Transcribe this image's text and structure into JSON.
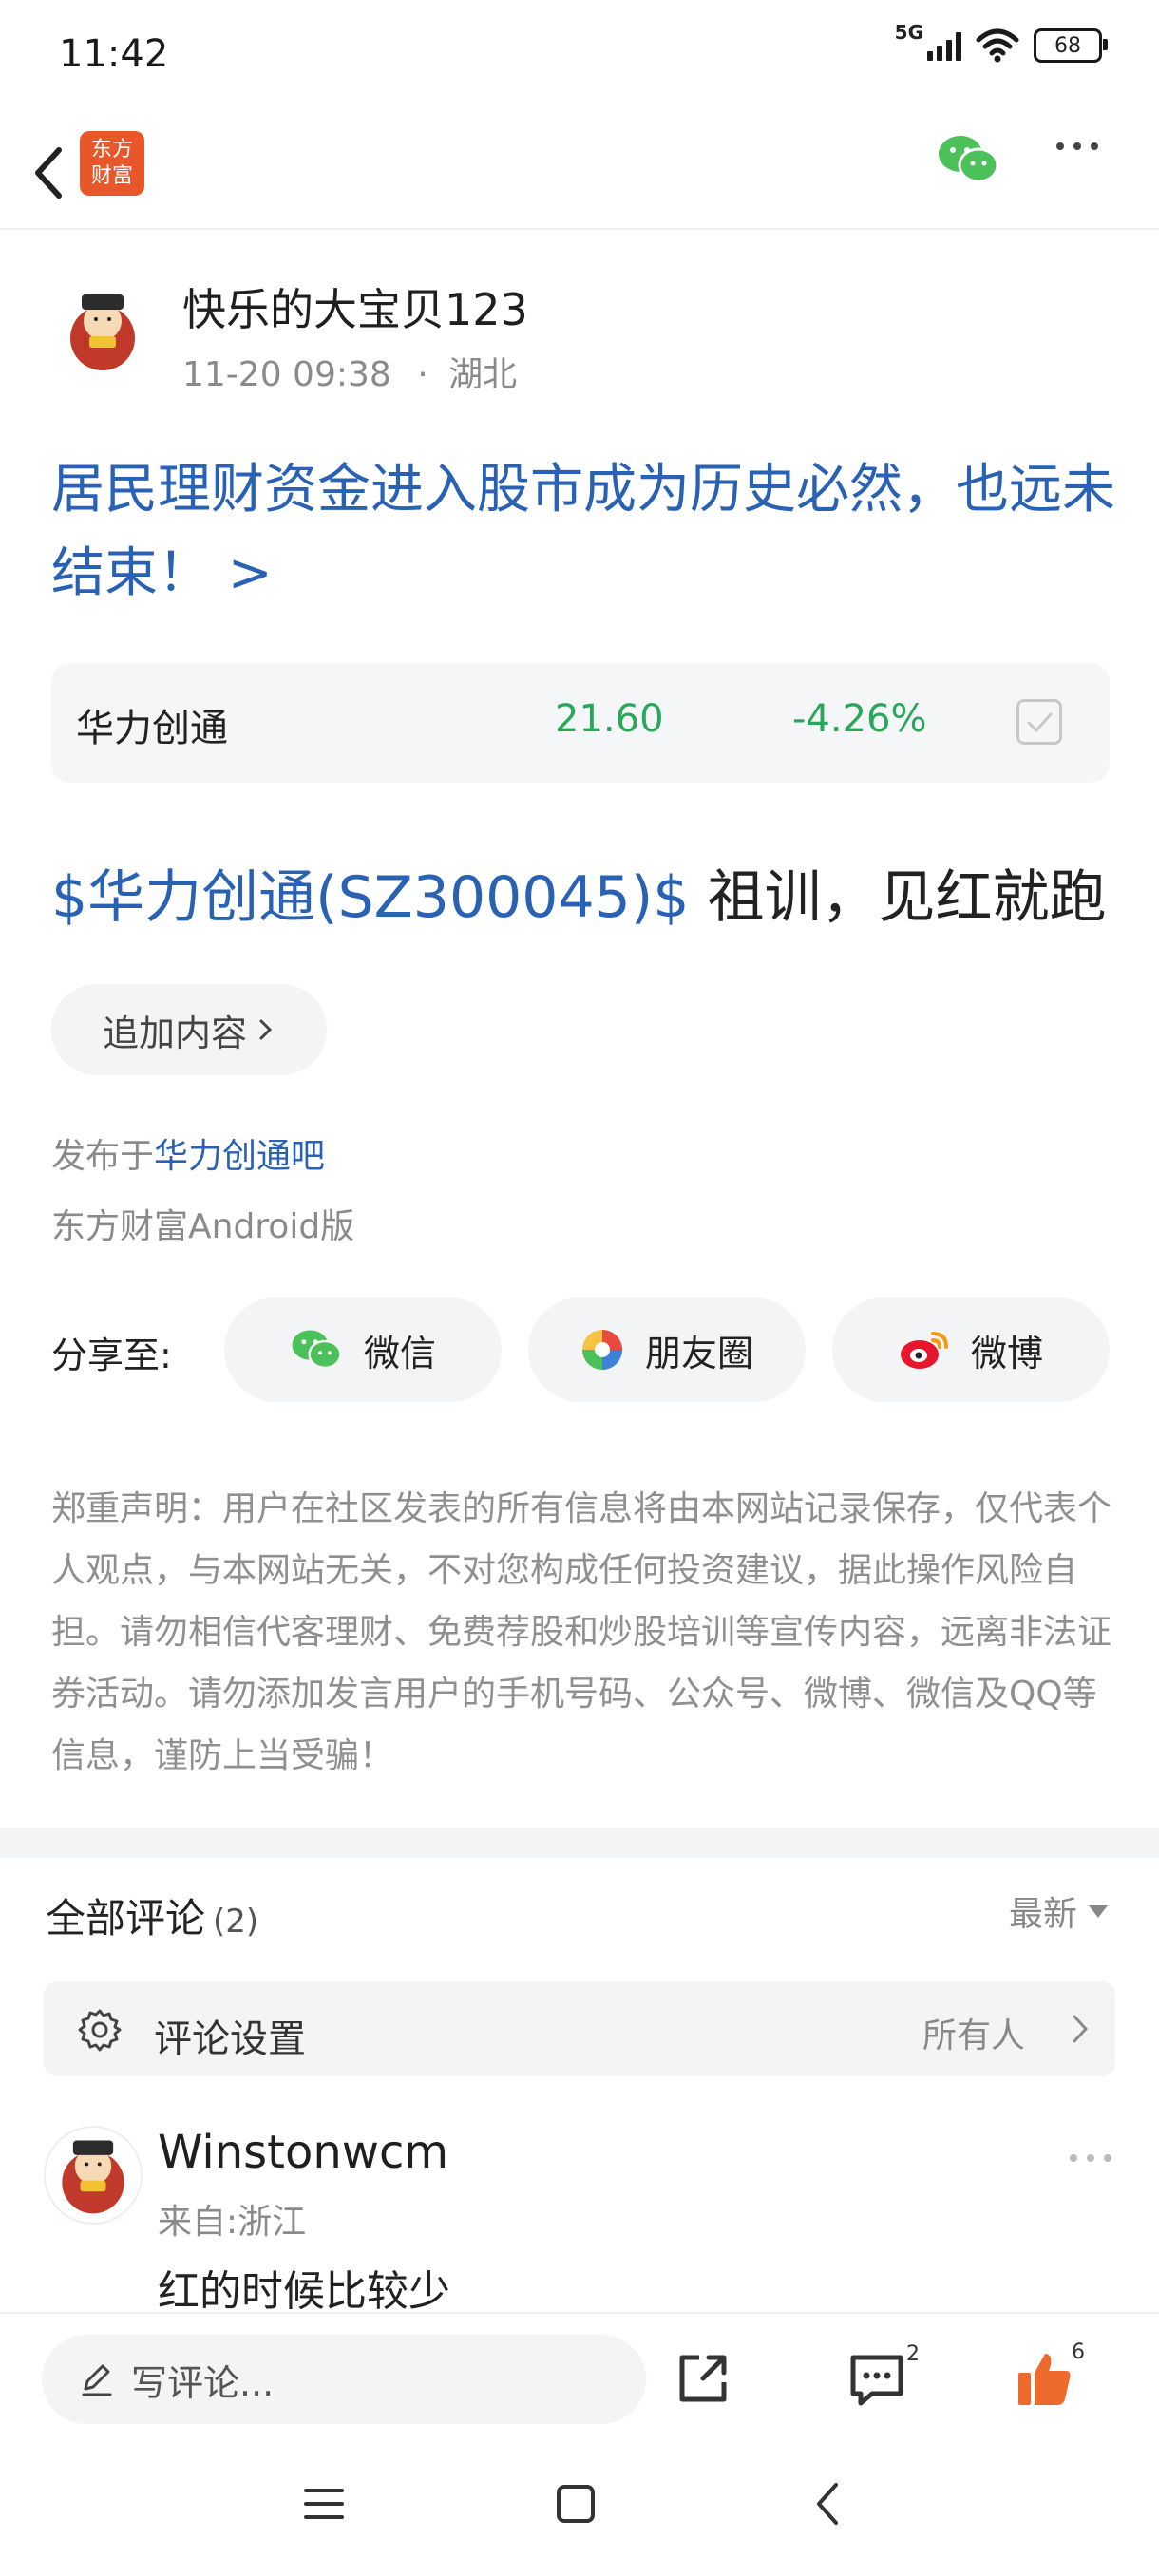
{
  "status_bar": {
    "time": "11:42",
    "network": "5G",
    "battery": "68"
  },
  "nav": {
    "logo_line1": "东方",
    "logo_line2": "财富"
  },
  "author": {
    "name": "快乐的大宝贝123",
    "time": "11-20 09:38",
    "sep": "·",
    "location": "湖北"
  },
  "post": {
    "title": "居民理财资金进入股市成为历史必然，也远未结束！ >",
    "stock": {
      "name": "华力创通",
      "price": "21.60",
      "change": "-4.26%"
    },
    "body_tag": "$华力创通(SZ300045)$",
    "body_text": " 祖训，见红就跑",
    "append_label": "追加内容",
    "published_prefix": "发布于",
    "published_bar": "华力创通吧",
    "client": "东方财富Android版"
  },
  "share": {
    "label": "分享至:",
    "wechat": "微信",
    "moments": "朋友圈",
    "weibo": "微博"
  },
  "disclaimer": "郑重声明：用户在社区发表的所有信息将由本网站记录保存，仅代表个人观点，与本网站无关，不对您构成任何投资建议，据此操作风险自担。请勿相信代客理财、免费荐股和炒股培训等宣传内容，远离非法证券活动。请勿添加发言用户的手机号码、公众号、微博、微信及QQ等信息，谨防上当受骗！",
  "comments": {
    "title": "全部评论",
    "count": "(2)",
    "sort": "最新",
    "settings_label": "评论设置",
    "settings_value": "所有人",
    "items": [
      {
        "name": "Winstonwcm",
        "location": "来自:浙江",
        "text": "红的时候比较少"
      }
    ]
  },
  "action_bar": {
    "placeholder": "写评论...",
    "comment_count": "2",
    "like_count": "6"
  },
  "colors": {
    "link_blue": "#2962b4",
    "stock_green": "#2aa75a",
    "like_orange": "#ee6a2c",
    "brand": "#e8572a"
  },
  "icons": [
    "back-icon",
    "wechat-icon",
    "more-icon",
    "check-icon",
    "chevron-right-icon",
    "moments-icon",
    "weibo-icon",
    "gear-icon",
    "pen-icon",
    "share-icon",
    "comment-icon",
    "thumbs-up-icon",
    "menu-icon",
    "home-icon"
  ]
}
